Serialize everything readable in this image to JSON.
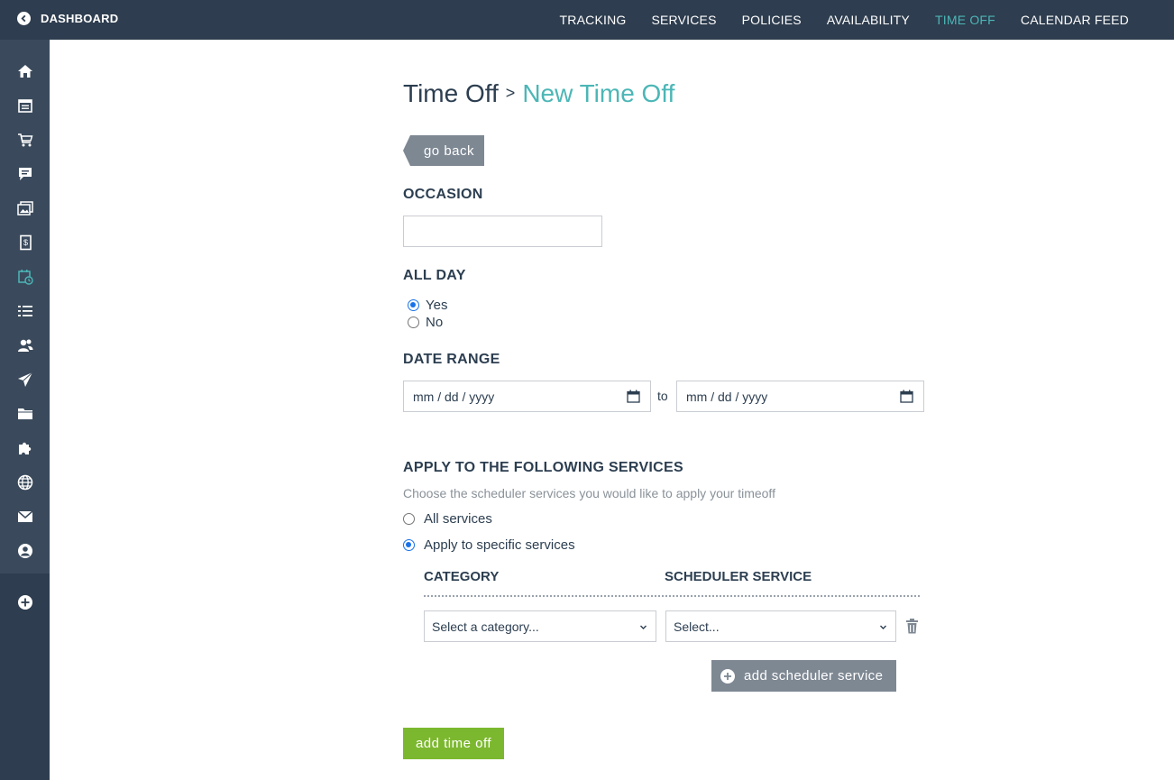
{
  "header": {
    "back_label": "DASHBOARD",
    "nav": [
      "TRACKING",
      "SERVICES",
      "POLICIES",
      "AVAILABILITY",
      "TIME OFF",
      "CALENDAR FEED"
    ],
    "active_nav": "TIME OFF"
  },
  "sidebar": {
    "icons": [
      "home-icon",
      "calendar-list-icon",
      "cart-icon",
      "chat-icon",
      "gallery-icon",
      "document-icon",
      "scheduler-icon",
      "list-icon",
      "users-icon",
      "send-icon",
      "folder-icon",
      "puzzle-icon",
      "globe-icon",
      "mail-icon",
      "account-icon",
      "add-circle-icon"
    ],
    "active_icon": "scheduler-icon"
  },
  "page": {
    "breadcrumb_parent": "Time Off",
    "breadcrumb_sep": ">",
    "breadcrumb_current": "New Time Off",
    "go_back": "go back"
  },
  "form": {
    "occasion_label": "OCCASION",
    "occasion_value": "",
    "all_day_label": "ALL DAY",
    "all_day_options": [
      "Yes",
      "No"
    ],
    "all_day_selected": "Yes",
    "date_range_label": "DATE RANGE",
    "date_from_placeholder": "mm / dd / yyyy",
    "date_to_placeholder": "mm / dd / yyyy",
    "date_sep": "to",
    "services_label": "APPLY TO THE FOLLOWING SERVICES",
    "services_hint": "Choose the scheduler services you would like to apply your timeoff",
    "services_options": [
      "All services",
      "Apply to specific services"
    ],
    "services_selected": "Apply to specific services",
    "col_category": "CATEGORY",
    "col_scheduler": "SCHEDULER SERVICE",
    "category_select": "Select a category...",
    "scheduler_select": "Select...",
    "add_scheduler_service": "add scheduler service",
    "submit": "add time off"
  },
  "colors": {
    "nav_bg": "#2e3d4f",
    "accent": "#4cb6b6",
    "button_gray": "#7e8893",
    "submit_green": "#7cb82f"
  }
}
